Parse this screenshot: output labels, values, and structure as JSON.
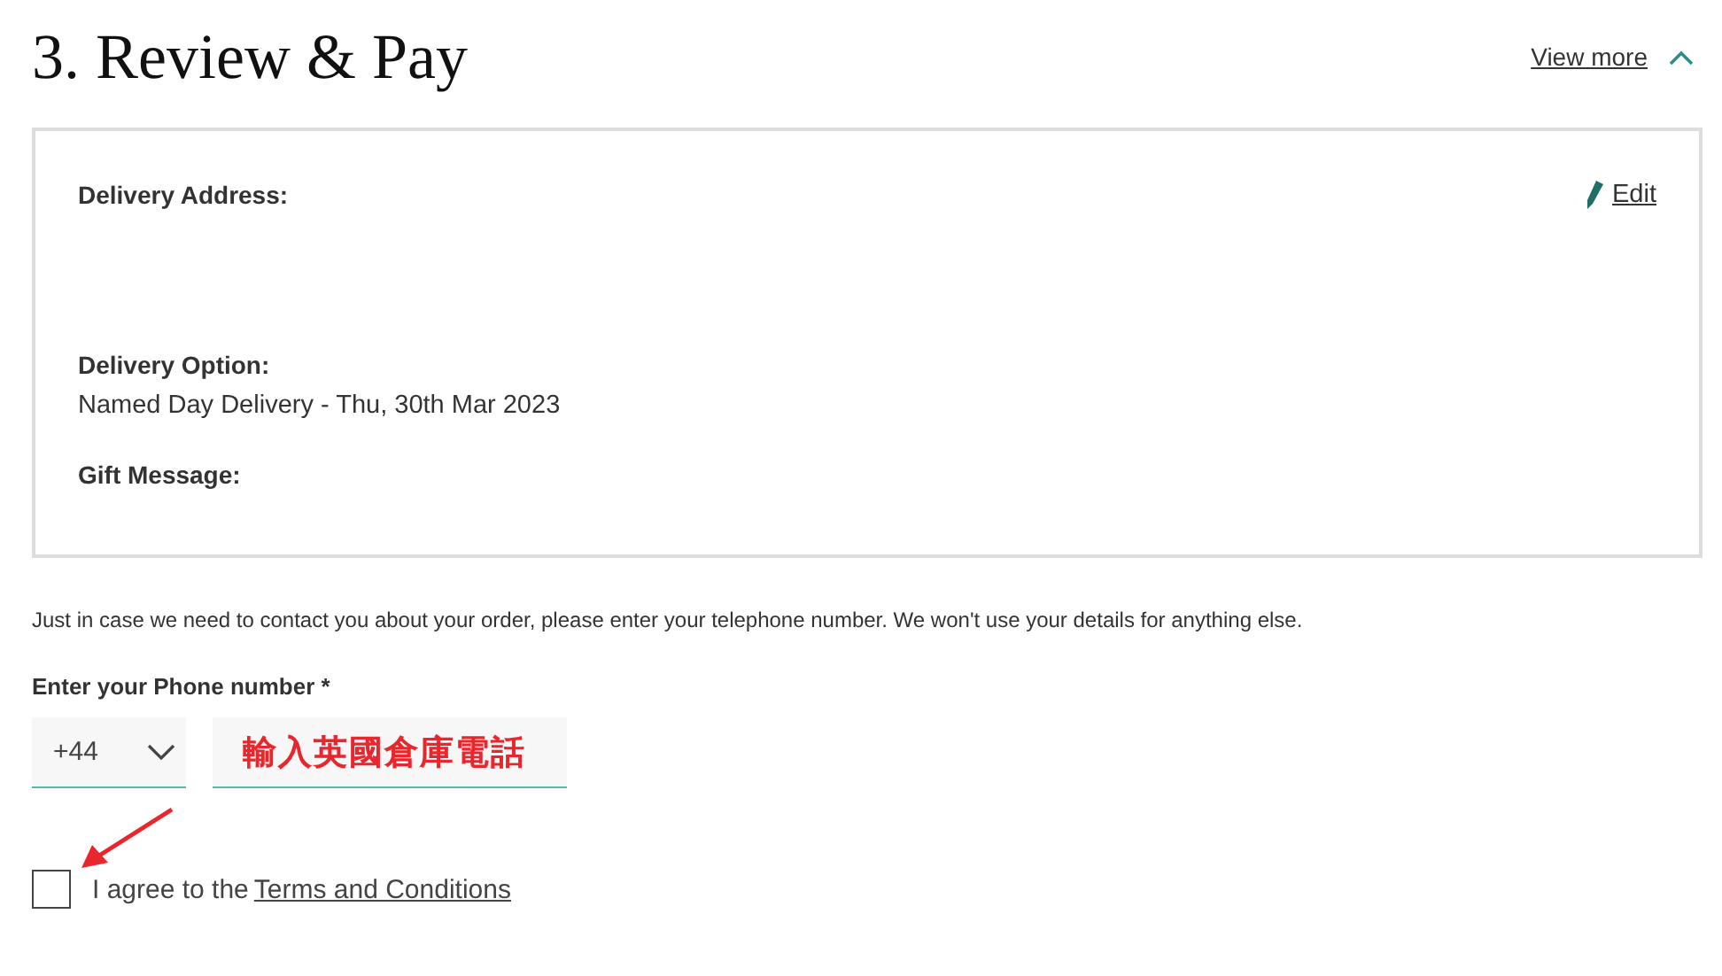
{
  "header": {
    "title": "3. Review & Pay",
    "toggle_label": "View more",
    "expanded": true
  },
  "summary": {
    "edit_label": "Edit",
    "sections": [
      {
        "label": "Delivery Address:"
      },
      {
        "label": "Delivery Option:",
        "value": "Named Day Delivery - Thu, 30th Mar 2023"
      },
      {
        "label": "Gift Message:"
      }
    ]
  },
  "phone": {
    "note": "Just in case we need to contact you about your order, please enter your telephone number.  We won't use your details for anything else.",
    "label": "Enter your Phone number *",
    "country_code": "+44",
    "annotation": "輸入英國倉庫電話"
  },
  "agree": {
    "checked": false,
    "text": "I agree to the",
    "link": "Terms and Conditions"
  }
}
